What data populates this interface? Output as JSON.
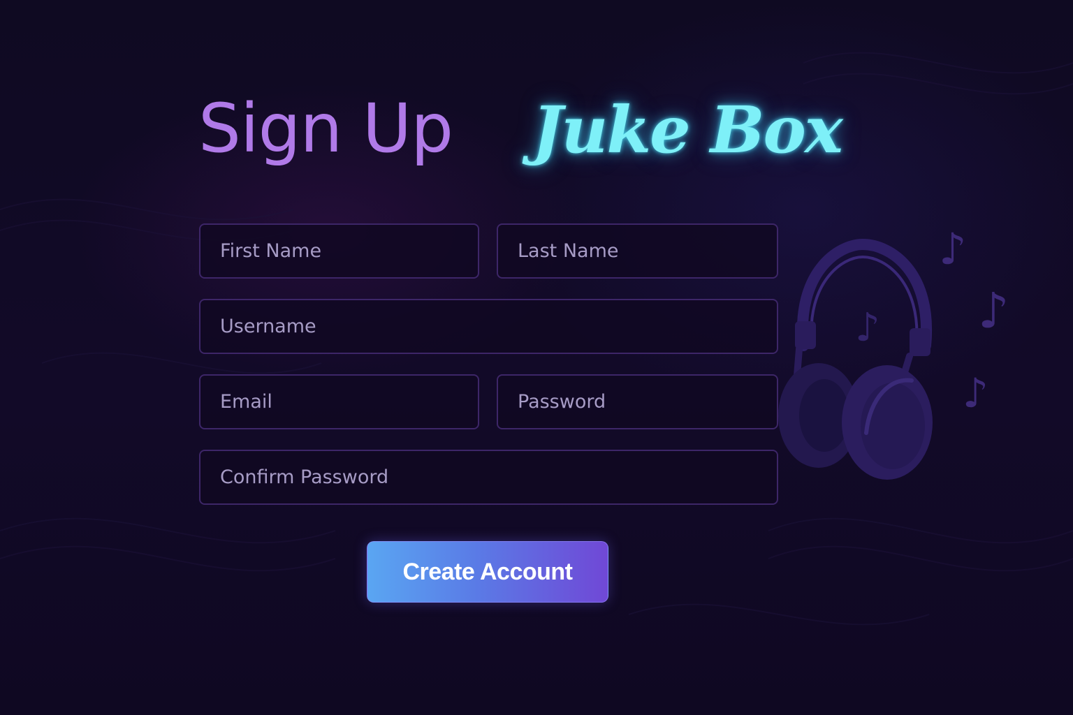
{
  "page": {
    "title": "Sign Up",
    "brand": "Juke Box"
  },
  "form": {
    "first_name": {
      "placeholder": "First Name",
      "value": ""
    },
    "last_name": {
      "placeholder": "Last Name",
      "value": ""
    },
    "username": {
      "placeholder": "Username",
      "value": ""
    },
    "email": {
      "placeholder": "Email",
      "value": ""
    },
    "password": {
      "placeholder": "Password",
      "value": ""
    },
    "confirm_password": {
      "placeholder": "Confirm Password",
      "value": ""
    },
    "submit_label": "Create Account"
  },
  "decoration": {
    "illustration": "headphones-icon",
    "notes": [
      "music-note-icon",
      "music-note-icon",
      "music-note-icon",
      "music-note-icon"
    ],
    "note_glyph": "♪"
  },
  "colors": {
    "background": "#0e0820",
    "title": "#b07ae8",
    "brand_neon": "#7ef0f8",
    "field_border": "#3d2668",
    "button_gradient_start": "#5aa6f2",
    "button_gradient_end": "#7048d6"
  }
}
